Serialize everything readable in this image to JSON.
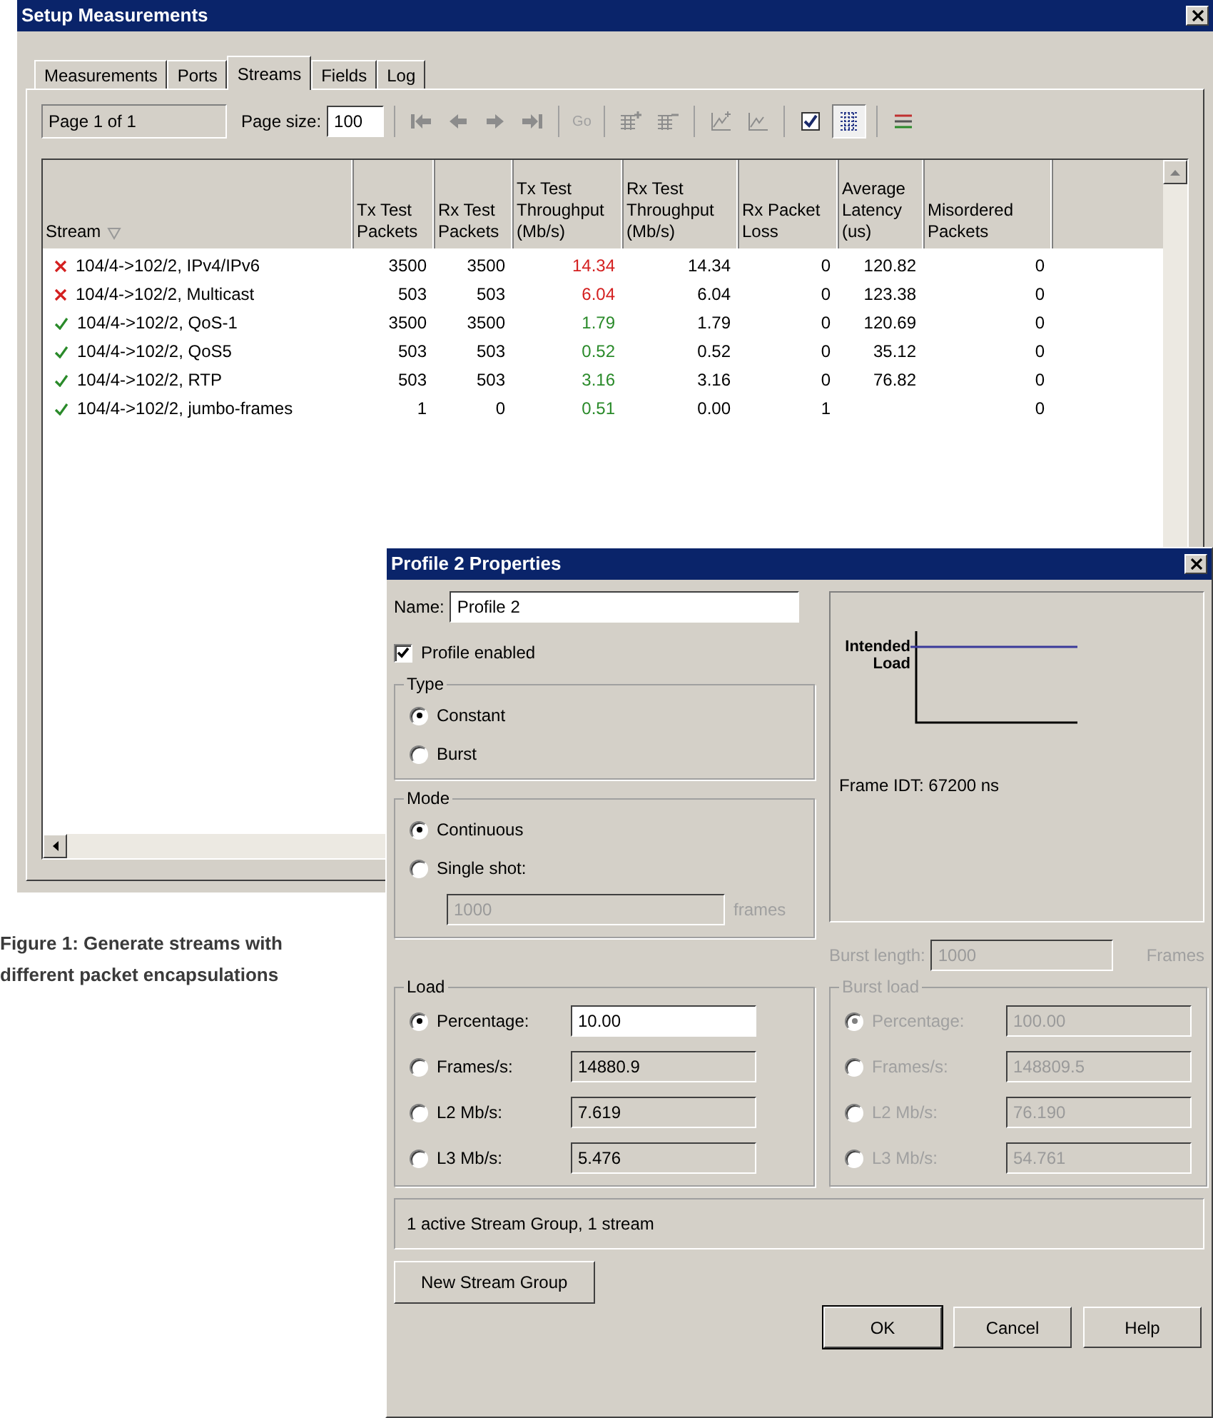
{
  "main_window": {
    "title": "Setup Measurements",
    "tabs": [
      {
        "label": "Measurements",
        "selected": false
      },
      {
        "label": "Ports",
        "selected": false
      },
      {
        "label": "Streams",
        "selected": true
      },
      {
        "label": "Fields",
        "selected": false
      },
      {
        "label": "Log",
        "selected": false
      }
    ],
    "toolbar": {
      "page_info": "Page 1 of 1",
      "page_size_label": "Page size:",
      "page_size": "100",
      "go_label": "Go",
      "grid_button_pressed": true
    },
    "table": {
      "columns": [
        "Stream",
        "Tx Test\nPackets",
        "Rx Test\nPackets",
        "Tx Test\nThroughput\n(Mb/s)",
        "Rx Test\nThroughput\n(Mb/s)",
        "Rx Packet\nLoss",
        "Average\nLatency\n(us)",
        "Misordered\nPackets"
      ],
      "rows": [
        {
          "passed": false,
          "cells": [
            "104/4->102/2, IPv4/IPv6",
            "3500",
            "3500",
            "14.34",
            "14.34",
            "0",
            "120.82",
            "0"
          ]
        },
        {
          "passed": false,
          "cells": [
            "104/4->102/2, Multicast",
            "503",
            "503",
            "6.04",
            "6.04",
            "0",
            "123.38",
            "0"
          ]
        },
        {
          "passed": true,
          "cells": [
            "104/4->102/2, QoS-1",
            "3500",
            "3500",
            "1.79",
            "1.79",
            "0",
            "120.69",
            "0"
          ]
        },
        {
          "passed": true,
          "cells": [
            "104/4->102/2, QoS5",
            "503",
            "503",
            "0.52",
            "0.52",
            "0",
            "35.12",
            "0"
          ]
        },
        {
          "passed": true,
          "cells": [
            "104/4->102/2, RTP",
            "503",
            "503",
            "3.16",
            "3.16",
            "0",
            "76.82",
            "0"
          ]
        },
        {
          "passed": true,
          "cells": [
            "104/4->102/2, jumbo-frames",
            "1",
            "0",
            "0.51",
            "0.00",
            "1",
            null,
            "0"
          ]
        }
      ]
    }
  },
  "caption": "Figure 1: Generate streams with different packet encapsulations",
  "dialog": {
    "title": "Profile 2 Properties",
    "name_label": "Name:",
    "name_value": "Profile 2",
    "profile_enabled": {
      "label": "Profile enabled",
      "checked": true
    },
    "type_group": {
      "title": "Type",
      "options": [
        {
          "label": "Constant",
          "selected": true
        },
        {
          "label": "Burst",
          "selected": false
        }
      ]
    },
    "mode_group": {
      "title": "Mode",
      "options": [
        {
          "label": "Continuous",
          "selected": true
        },
        {
          "label": "Single shot:",
          "selected": false
        }
      ],
      "frames_value": "1000",
      "frames_unit": "frames",
      "frames_disabled": true
    },
    "preview": {
      "axis_label": "Intended\nLoad",
      "frame_idt": "Frame IDT: 67200 ns"
    },
    "burst_length": {
      "label": "Burst length:",
      "value": "1000",
      "unit": "Frames",
      "disabled": true
    },
    "load_group": {
      "title": "Load",
      "disabled": false,
      "rows": [
        {
          "label": "Percentage:",
          "value": "10.00",
          "selected": true,
          "editable": true
        },
        {
          "label": "Frames/s:",
          "value": "14880.9",
          "selected": false,
          "editable": false
        },
        {
          "label": "L2 Mb/s:",
          "value": "7.619",
          "selected": false,
          "editable": false
        },
        {
          "label": "L3 Mb/s:",
          "value": "5.476",
          "selected": false,
          "editable": false
        }
      ]
    },
    "burst_load_group": {
      "title": "Burst load",
      "disabled": true,
      "rows": [
        {
          "label": "Percentage:",
          "value": "100.00",
          "selected": true,
          "editable": false
        },
        {
          "label": "Frames/s:",
          "value": "148809.5",
          "selected": false,
          "editable": false
        },
        {
          "label": "L2 Mb/s:",
          "value": "76.190",
          "selected": false,
          "editable": false
        },
        {
          "label": "L3 Mb/s:",
          "value": "54.761",
          "selected": false,
          "editable": false
        }
      ]
    },
    "status": "1 active Stream Group, 1 stream",
    "new_group_button": "New Stream Group",
    "buttons": [
      "OK",
      "Cancel",
      "Help"
    ]
  }
}
